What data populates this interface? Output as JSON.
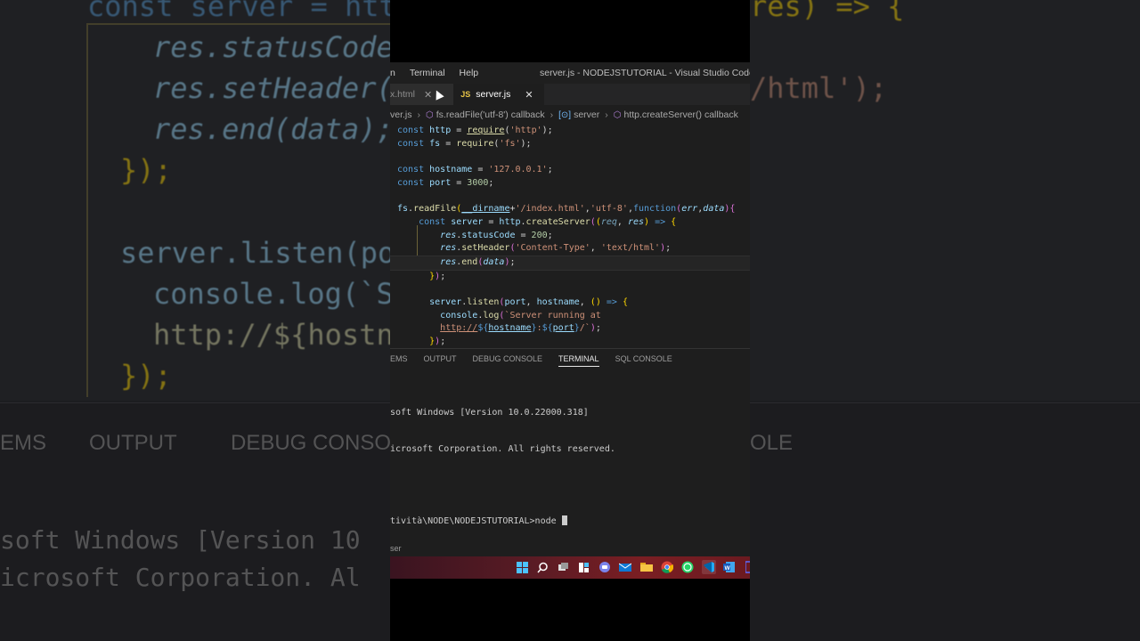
{
  "titlebar": {
    "menu": [
      "n",
      "Terminal",
      "Help"
    ],
    "window_title": "server.js - NODEJSTUTORIAL - Visual Studio Code [Admini"
  },
  "tabs": [
    {
      "label": "x.html",
      "active": false
    },
    {
      "label": "server.js",
      "active": true,
      "icon": "JS"
    }
  ],
  "breadcrumb": [
    "ver.js",
    "fs.readFile('utf-8') callback",
    "server",
    "http.createServer() callback"
  ],
  "code_lines": [
    "const http = require('http');",
    "const fs = require('fs');",
    "",
    "const hostname = '127.0.0.1';",
    "const port = 3000;",
    "",
    "fs.readFile(__dirname+'/index.html','utf-8',function(err,data){",
    "    const server = http.createServer((req, res) => {",
    "        res.statusCode = 200;",
    "        res.setHeader('Content-Type', 'text/html');",
    "        res.end(data);",
    "    });",
    "",
    "    server.listen(port, hostname, () => {",
    "      console.log(`Server running at",
    "      http://${hostname}:${port}/`);",
    "    });"
  ],
  "panel": {
    "tabs": [
      "EMS",
      "OUTPUT",
      "DEBUG CONSOLE",
      "TERMINAL",
      "SQL CONSOLE"
    ],
    "active_tab": "TERMINAL"
  },
  "terminal": {
    "line1": "soft Windows [Version 10.0.22000.318]",
    "line2": "icrosoft Corporation. All rights reserved.",
    "prompt": "tività\\NODE\\NODEJSTUTORIAL>node "
  },
  "statusbar": {
    "text": "ser"
  },
  "taskbar": {
    "icons": [
      "windows-icon",
      "search-icon",
      "task-view-icon",
      "widgets-icon",
      "teams-icon",
      "mail-icon",
      "folder-icon",
      "chrome-icon",
      "whatsapp-icon",
      "vscode-icon",
      "word-icon",
      "app-icon"
    ]
  },
  "background": {
    "code_lines": [
      "const server = htt",
      "res.statusCode",
      "res.setHeader(",
      "res.end(data);",
      "});",
      "server.listen(po",
      "console.log(`S",
      "http://${hostn",
      "});"
    ],
    "right_fragments": [
      "res) => {",
      "/html');"
    ],
    "tabs": [
      "EMS",
      "OUTPUT",
      "DEBUG CONSO",
      "OLE"
    ],
    "term_lines": [
      "soft Windows [Version 10",
      "icrosoft Corporation. Al"
    ]
  },
  "colors": {
    "editor_bg": "#1e1e1e",
    "keyword": "#569cd6",
    "variable": "#9cdcfe",
    "function": "#dcdcaa",
    "string": "#ce9178",
    "number": "#b5cea8",
    "bracket": "#ffd700"
  }
}
